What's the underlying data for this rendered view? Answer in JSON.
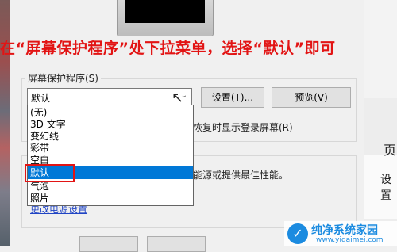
{
  "instruction": "在“屏幕保护程序”处下拉菜单，选择“默认”即可",
  "screensaver": {
    "group_label": "屏幕保护程序(S)",
    "current_value": "默认",
    "settings_button": "设置(T)...",
    "preview_button": "预览(V)",
    "resume_text": "恢复时显示登录屏幕(R)",
    "options": [
      "(无)",
      "3D 文字",
      "变幻线",
      "彩带",
      "空白",
      "默认",
      "气泡",
      "照片"
    ],
    "selected_index": 5
  },
  "power": {
    "text": "能源或提供最佳性能。",
    "link": "更改电源设置"
  },
  "right_panel": {
    "label1": "页",
    "label2": "设置"
  },
  "watermark": {
    "title": "纯净系统家园",
    "url": "www.yidaimei.com"
  },
  "colors": {
    "instruction": "#e21414",
    "selection": "#0078d7",
    "highlight_box": "#e21414",
    "link": "#2044c4",
    "watermark": "#1b8be0"
  }
}
